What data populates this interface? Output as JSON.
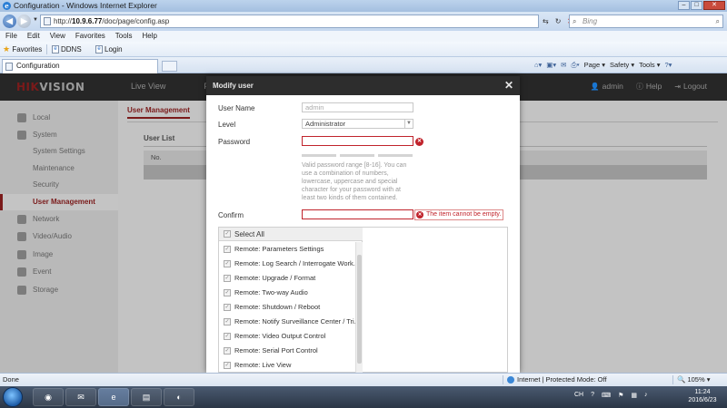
{
  "window": {
    "title": "Configuration - Windows Internet Explorer",
    "controls": {
      "minimize": "–",
      "maximize": "□",
      "close": "✕"
    }
  },
  "browser": {
    "url_prefix": "http://",
    "url_host": "10.9.6.77",
    "url_path": "/doc/page/config.asp",
    "search_placeholder": "Bing",
    "menu": [
      "File",
      "Edit",
      "View",
      "Favorites",
      "Tools",
      "Help"
    ],
    "favorites_label": "Favorites",
    "fav_links": [
      "DDNS",
      "Login"
    ],
    "tab_title": "Configuration",
    "commands": [
      "Page ▾",
      "Safety ▾",
      "Tools ▾"
    ],
    "status_left": "Done",
    "status_zone": "Internet | Protected Mode: Off",
    "zoom": "105%"
  },
  "app": {
    "brand": "VISION",
    "brand_red": "HIK",
    "top_nav": [
      "Live View",
      "P"
    ],
    "user_tools": {
      "user": "admin",
      "help": "Help",
      "logout": "Logout"
    },
    "sidebar": [
      {
        "label": "Local",
        "type": "main"
      },
      {
        "label": "System",
        "type": "main"
      },
      {
        "label": "System Settings",
        "type": "sub"
      },
      {
        "label": "Maintenance",
        "type": "sub"
      },
      {
        "label": "Security",
        "type": "sub"
      },
      {
        "label": "User Management",
        "type": "sub",
        "active": true
      },
      {
        "label": "Network",
        "type": "main"
      },
      {
        "label": "Video/Audio",
        "type": "main"
      },
      {
        "label": "Image",
        "type": "main"
      },
      {
        "label": "Event",
        "type": "main"
      },
      {
        "label": "Storage",
        "type": "main"
      }
    ],
    "content_tab": "User Management",
    "user_list_title": "User List",
    "user_list_col_no": "No."
  },
  "modal": {
    "title": "Modify user",
    "close": "✕",
    "labels": {
      "username": "User Name",
      "level": "Level",
      "password": "Password",
      "confirm": "Confirm"
    },
    "username_value": "admin",
    "level_value": "Administrator",
    "password_hint": "Valid password range [8-16]. You can use a combination of numbers, lowercase, uppercase and special character for your password with at least two kinds of them contained.",
    "confirm_error": "The item cannot be empty.",
    "select_all": "Select All",
    "permissions": [
      "Remote: Parameters Settings",
      "Remote: Log Search / Interrogate Work...",
      "Remote: Upgrade / Format",
      "Remote: Two-way Audio",
      "Remote: Shutdown / Reboot",
      "Remote: Notify Surveillance Center / Tri...",
      "Remote: Video Output Control",
      "Remote: Serial Port Control",
      "Remote: Live View"
    ]
  },
  "taskbar": {
    "tray_lang": "CH",
    "time": "11:24",
    "date": "2016/6/23"
  },
  "colors": {
    "brand_red": "#7a1a1a",
    "error_red": "#c0232b",
    "header_dark": "#262626"
  }
}
